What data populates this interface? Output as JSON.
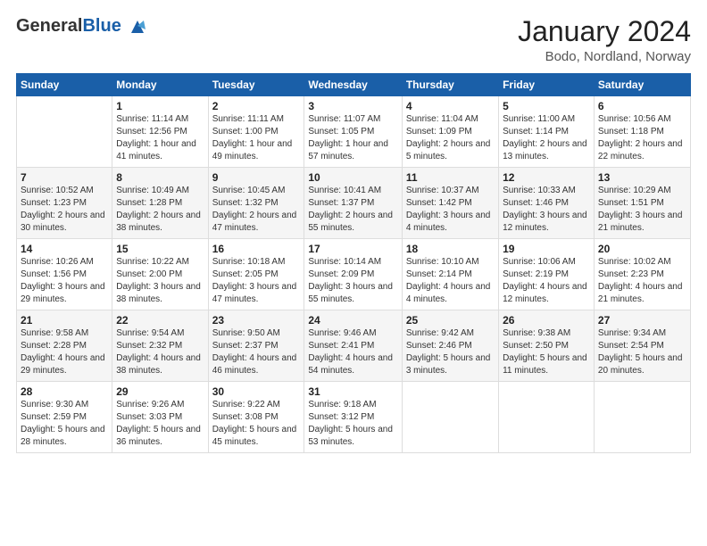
{
  "header": {
    "logo_general": "General",
    "logo_blue": "Blue",
    "month_year": "January 2024",
    "location": "Bodo, Nordland, Norway"
  },
  "weekdays": [
    "Sunday",
    "Monday",
    "Tuesday",
    "Wednesday",
    "Thursday",
    "Friday",
    "Saturday"
  ],
  "weeks": [
    [
      {
        "day": "",
        "info": ""
      },
      {
        "day": "1",
        "info": "Sunrise: 11:14 AM\nSunset: 12:56 PM\nDaylight: 1 hour and 41 minutes."
      },
      {
        "day": "2",
        "info": "Sunrise: 11:11 AM\nSunset: 1:00 PM\nDaylight: 1 hour and 49 minutes."
      },
      {
        "day": "3",
        "info": "Sunrise: 11:07 AM\nSunset: 1:05 PM\nDaylight: 1 hour and 57 minutes."
      },
      {
        "day": "4",
        "info": "Sunrise: 11:04 AM\nSunset: 1:09 PM\nDaylight: 2 hours and 5 minutes."
      },
      {
        "day": "5",
        "info": "Sunrise: 11:00 AM\nSunset: 1:14 PM\nDaylight: 2 hours and 13 minutes."
      },
      {
        "day": "6",
        "info": "Sunrise: 10:56 AM\nSunset: 1:18 PM\nDaylight: 2 hours and 22 minutes."
      }
    ],
    [
      {
        "day": "7",
        "info": "Sunrise: 10:52 AM\nSunset: 1:23 PM\nDaylight: 2 hours and 30 minutes."
      },
      {
        "day": "8",
        "info": "Sunrise: 10:49 AM\nSunset: 1:28 PM\nDaylight: 2 hours and 38 minutes."
      },
      {
        "day": "9",
        "info": "Sunrise: 10:45 AM\nSunset: 1:32 PM\nDaylight: 2 hours and 47 minutes."
      },
      {
        "day": "10",
        "info": "Sunrise: 10:41 AM\nSunset: 1:37 PM\nDaylight: 2 hours and 55 minutes."
      },
      {
        "day": "11",
        "info": "Sunrise: 10:37 AM\nSunset: 1:42 PM\nDaylight: 3 hours and 4 minutes."
      },
      {
        "day": "12",
        "info": "Sunrise: 10:33 AM\nSunset: 1:46 PM\nDaylight: 3 hours and 12 minutes."
      },
      {
        "day": "13",
        "info": "Sunrise: 10:29 AM\nSunset: 1:51 PM\nDaylight: 3 hours and 21 minutes."
      }
    ],
    [
      {
        "day": "14",
        "info": "Sunrise: 10:26 AM\nSunset: 1:56 PM\nDaylight: 3 hours and 29 minutes."
      },
      {
        "day": "15",
        "info": "Sunrise: 10:22 AM\nSunset: 2:00 PM\nDaylight: 3 hours and 38 minutes."
      },
      {
        "day": "16",
        "info": "Sunrise: 10:18 AM\nSunset: 2:05 PM\nDaylight: 3 hours and 47 minutes."
      },
      {
        "day": "17",
        "info": "Sunrise: 10:14 AM\nSunset: 2:09 PM\nDaylight: 3 hours and 55 minutes."
      },
      {
        "day": "18",
        "info": "Sunrise: 10:10 AM\nSunset: 2:14 PM\nDaylight: 4 hours and 4 minutes."
      },
      {
        "day": "19",
        "info": "Sunrise: 10:06 AM\nSunset: 2:19 PM\nDaylight: 4 hours and 12 minutes."
      },
      {
        "day": "20",
        "info": "Sunrise: 10:02 AM\nSunset: 2:23 PM\nDaylight: 4 hours and 21 minutes."
      }
    ],
    [
      {
        "day": "21",
        "info": "Sunrise: 9:58 AM\nSunset: 2:28 PM\nDaylight: 4 hours and 29 minutes."
      },
      {
        "day": "22",
        "info": "Sunrise: 9:54 AM\nSunset: 2:32 PM\nDaylight: 4 hours and 38 minutes."
      },
      {
        "day": "23",
        "info": "Sunrise: 9:50 AM\nSunset: 2:37 PM\nDaylight: 4 hours and 46 minutes."
      },
      {
        "day": "24",
        "info": "Sunrise: 9:46 AM\nSunset: 2:41 PM\nDaylight: 4 hours and 54 minutes."
      },
      {
        "day": "25",
        "info": "Sunrise: 9:42 AM\nSunset: 2:46 PM\nDaylight: 5 hours and 3 minutes."
      },
      {
        "day": "26",
        "info": "Sunrise: 9:38 AM\nSunset: 2:50 PM\nDaylight: 5 hours and 11 minutes."
      },
      {
        "day": "27",
        "info": "Sunrise: 9:34 AM\nSunset: 2:54 PM\nDaylight: 5 hours and 20 minutes."
      }
    ],
    [
      {
        "day": "28",
        "info": "Sunrise: 9:30 AM\nSunset: 2:59 PM\nDaylight: 5 hours and 28 minutes."
      },
      {
        "day": "29",
        "info": "Sunrise: 9:26 AM\nSunset: 3:03 PM\nDaylight: 5 hours and 36 minutes."
      },
      {
        "day": "30",
        "info": "Sunrise: 9:22 AM\nSunset: 3:08 PM\nDaylight: 5 hours and 45 minutes."
      },
      {
        "day": "31",
        "info": "Sunrise: 9:18 AM\nSunset: 3:12 PM\nDaylight: 5 hours and 53 minutes."
      },
      {
        "day": "",
        "info": ""
      },
      {
        "day": "",
        "info": ""
      },
      {
        "day": "",
        "info": ""
      }
    ]
  ]
}
